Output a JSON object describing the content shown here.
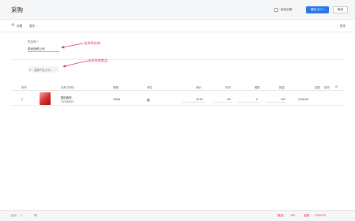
{
  "header": {
    "title": "采购",
    "checkbox_label": "继续创建",
    "confirm_label": "确定 (⌘↵)",
    "cancel_label": "取消"
  },
  "toolbar": {
    "settings_label": "设置",
    "more_label": "更多",
    "right_more_label": "更多"
  },
  "supplier": {
    "label": "供应商 *",
    "value": "泰尚商贸公司"
  },
  "annotations": {
    "supplier_hint": "选择供应商",
    "product_hint": "选择采购商品"
  },
  "search": {
    "placeholder": "选择产品 (F3)"
  },
  "table": {
    "headers": [
      "序号",
      "名称 (货号)",
      "规格",
      "单位",
      "单价",
      "折扣",
      "赠数",
      "数量",
      "金额",
      "操作"
    ],
    "rows": [
      {
        "index": "1",
        "name": "酸奶团球",
        "code": "CX100033",
        "spec": "200ml",
        "unit": "箱",
        "price": "30.00",
        "discount": "0%",
        "gift": "0",
        "qty": "100",
        "amount": "3,000.00"
      }
    ]
  },
  "footer": {
    "total_label": "合计",
    "total_count": "1",
    "items_label": "项",
    "qty_label": "数量：",
    "qty_value": "100",
    "amount_label": "金额：",
    "amount_value": "3,000.00"
  },
  "colors": {
    "primary": "#2a78e8",
    "annotation": "#e0306e",
    "total_red": "#e0303c"
  }
}
